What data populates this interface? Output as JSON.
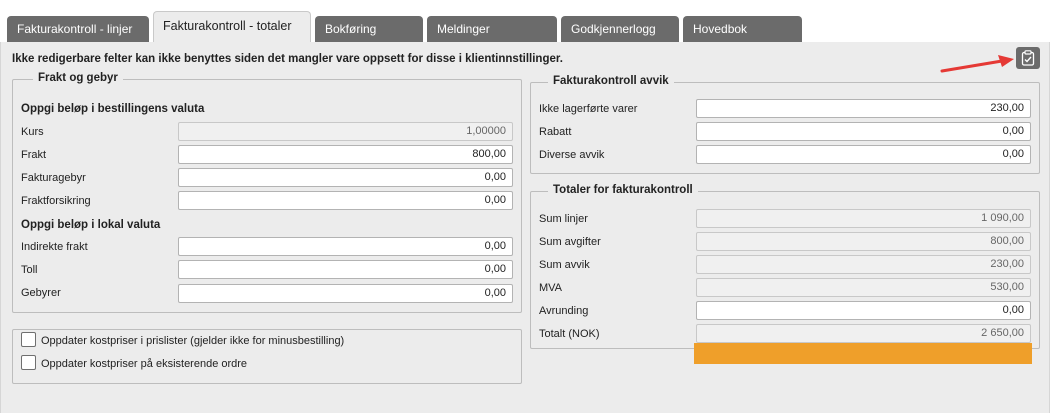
{
  "tabs": [
    {
      "label": "Fakturakontroll - linjer"
    },
    {
      "label": "Fakturakontroll - totaler"
    },
    {
      "label": "Bokføring"
    },
    {
      "label": "Meldinger"
    },
    {
      "label": "Godkjennerlogg"
    },
    {
      "label": "Hovedbok"
    }
  ],
  "notice": "Ikke redigerbare felter kan ikke benyttes siden det mangler vare oppsett for disse i klientinnstillinger.",
  "frakt": {
    "legend": "Frakt og gebyr",
    "heading_order": "Oppgi beløp i bestillingens valuta",
    "heading_local": "Oppgi beløp i lokal valuta",
    "rows": [
      {
        "label": "Kurs",
        "value": "1,00000"
      },
      {
        "label": "Frakt",
        "value": "800,00"
      },
      {
        "label": "Fakturagebyr",
        "value": "0,00"
      },
      {
        "label": "Fraktforsikring",
        "value": "0,00"
      },
      {
        "label": "Indirekte frakt",
        "value": "0,00"
      },
      {
        "label": "Toll",
        "value": "0,00"
      },
      {
        "label": "Gebyrer",
        "value": "0,00"
      }
    ]
  },
  "options": [
    {
      "label": "Oppdater kostpriser i prislister (gjelder ikke for minusbestilling)",
      "checked": false
    },
    {
      "label": "Oppdater kostpriser på eksisterende ordre",
      "checked": false
    }
  ],
  "avvik": {
    "legend": "Fakturakontroll avvik",
    "rows": [
      {
        "label": "Ikke lagerførte varer",
        "value": "230,00"
      },
      {
        "label": "Rabatt",
        "value": "0,00"
      },
      {
        "label": "Diverse avvik",
        "value": "0,00"
      }
    ]
  },
  "totaler": {
    "legend": "Totaler for fakturakontroll",
    "rows": [
      {
        "label": "Sum linjer",
        "value": "1 090,00"
      },
      {
        "label": "Sum avgifter",
        "value": "800,00"
      },
      {
        "label": "Sum avvik",
        "value": "230,00"
      },
      {
        "label": "MVA",
        "value": "530,00"
      },
      {
        "label": "Avrunding",
        "value": "0,00"
      },
      {
        "label": "Totalt (NOK)",
        "value": "2 650,00"
      }
    ]
  },
  "icons": {
    "copy": "clipboard-check-icon",
    "arrow": "red-arrow-icon"
  },
  "colors": {
    "tab": "#6b6b6b",
    "panel": "#ececec",
    "arrow": "#e53935",
    "highlight": "#ef9f2a"
  }
}
